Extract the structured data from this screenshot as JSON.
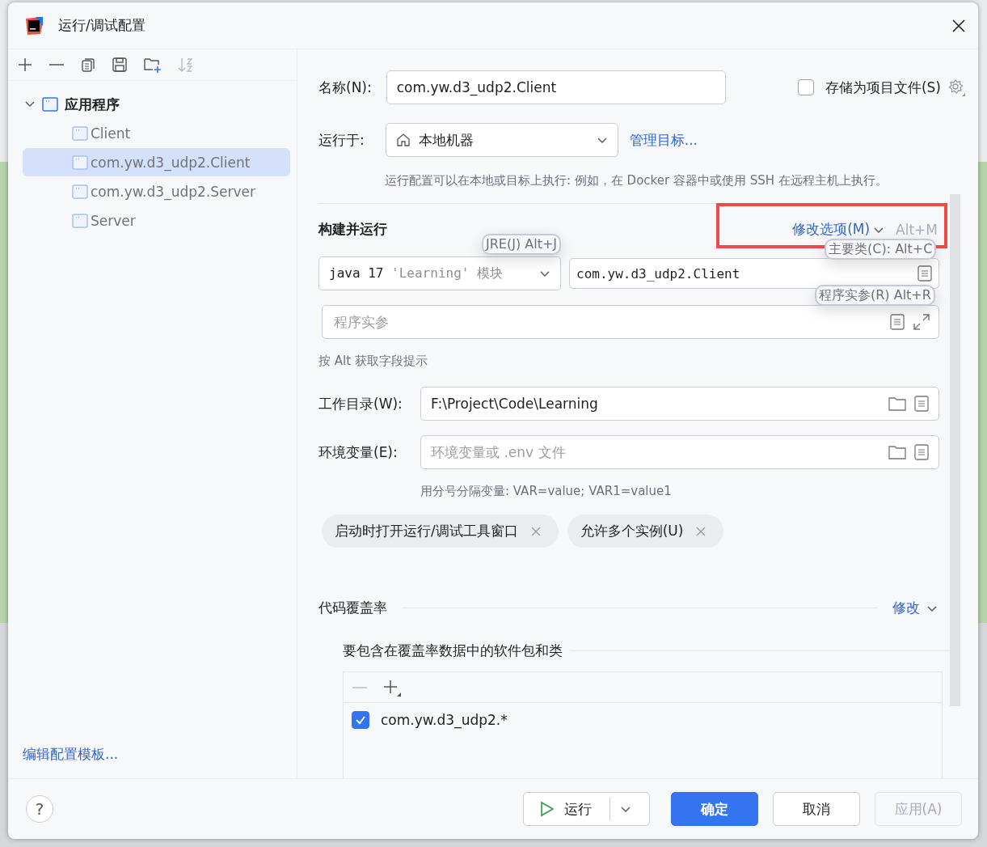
{
  "window": {
    "title": "运行/调试配置"
  },
  "tree": {
    "label": "应用程序",
    "expanded": true,
    "children": [
      {
        "label": "Client",
        "selected": false
      },
      {
        "label": "com.yw.d3_udp2.Client",
        "selected": true
      },
      {
        "label": "com.yw.d3_udp2.Server",
        "selected": false
      },
      {
        "label": "Server",
        "selected": false
      }
    ]
  },
  "edit_templates_link": "编辑配置模板...",
  "name": {
    "label": "名称(N):",
    "value": "com.yw.d3_udp2.Client"
  },
  "store_as_project_file": {
    "label": "存储为项目文件(S)",
    "checked": false
  },
  "run_on": {
    "label": "运行于:",
    "value": "本地机器",
    "manage_link": "管理目标...",
    "hint": "运行配置可以在本地或目标上执行: 例如，在 Docker 容器中或使用 SSH 在远程主机上执行。"
  },
  "build_run": {
    "title": "构建并运行",
    "modify_options": {
      "label": "修改选项(M)",
      "shortcut": "Alt+M"
    },
    "jre": {
      "version": "java 17",
      "module": "'Learning'",
      "suffix": "模块"
    },
    "main_class": "com.yw.d3_udp2.Client",
    "program_args": {
      "placeholder": "程序实参"
    },
    "alt_hint": "按 Alt 获取字段提示"
  },
  "tooltips": [
    {
      "text": "JRE(J) Alt+J"
    },
    {
      "text": "主要类(C): Alt+C"
    },
    {
      "text": "程序实参(R) Alt+R"
    }
  ],
  "working_dir": {
    "label": "工作目录(W):",
    "value": "F:\\Project\\Code\\Learning"
  },
  "env": {
    "label": "环境变量(E):",
    "placeholder": "环境变量或 .env 文件",
    "hint": "用分号分隔变量: VAR=value; VAR1=value1"
  },
  "chips": [
    {
      "label": "启动时打开运行/调试工具窗口"
    },
    {
      "label": "允许多个实例(U)"
    }
  ],
  "coverage": {
    "title": "代码覆盖率",
    "modify": "修改",
    "subtitle": "要包含在覆盖率数据中的软件包和类",
    "items": [
      {
        "label": "com.yw.d3_udp2.*",
        "checked": true
      }
    ]
  },
  "footer": {
    "help": "?",
    "run": "运行",
    "ok": "确定",
    "cancel": "取消",
    "apply": {
      "label": "应用(A)",
      "disabled": true
    }
  }
}
